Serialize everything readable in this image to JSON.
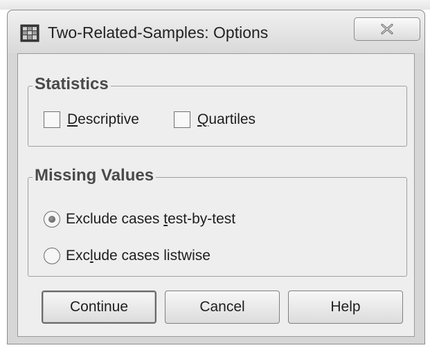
{
  "window": {
    "title": "Two-Related-Samples: Options"
  },
  "icons": {
    "app": "table-grid-icon",
    "close": "close-icon"
  },
  "statistics": {
    "title": "Statistics",
    "options": [
      {
        "label": "Descriptive",
        "mnemonic": "D",
        "rest": "escriptive",
        "checked": false
      },
      {
        "label": "Quartiles",
        "mnemonic": "Q",
        "rest": "uartiles",
        "checked": false
      }
    ]
  },
  "missing_values": {
    "title": "Missing Values",
    "options": [
      {
        "label": "Exclude cases test-by-test",
        "before": "Exclude cases ",
        "mnemonic": "t",
        "after": "est-by-test",
        "selected": true
      },
      {
        "label": "Exclude cases listwise",
        "before": "Exc",
        "mnemonic": "l",
        "after": "ude cases listwise",
        "selected": false
      }
    ]
  },
  "buttons": {
    "continue": "Continue",
    "cancel": "Cancel",
    "help": "Help"
  }
}
